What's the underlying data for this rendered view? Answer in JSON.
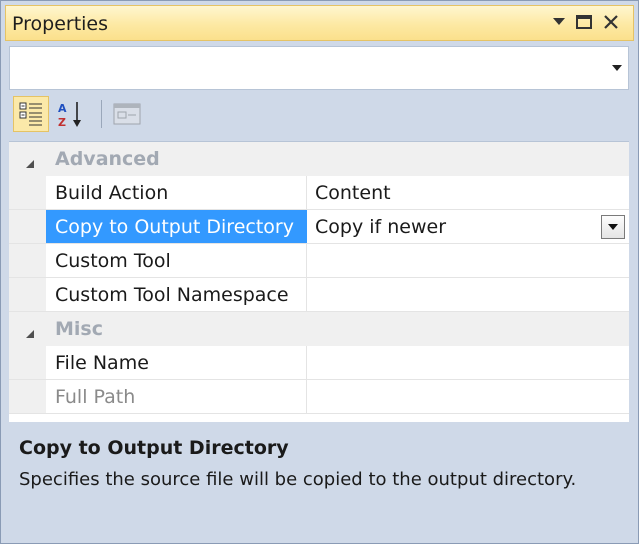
{
  "window": {
    "title": "Properties",
    "buttons": {
      "dropdown": "window-position-icon",
      "maximize": "maximize-icon",
      "close": "close-icon"
    }
  },
  "selector": {
    "value": "",
    "arrow_icon": "dropdown-arrow-icon"
  },
  "toolbar": {
    "categorized_icon": "categorized-icon",
    "alphabetical_icon": "alphabetical-sort-icon",
    "property_pages_icon": "property-pages-icon"
  },
  "grid": {
    "categories": [
      {
        "label": "Advanced",
        "properties": [
          {
            "name": "Build Action",
            "value": "Content"
          },
          {
            "name": "Copy to Output Directory",
            "value": "Copy if newer"
          },
          {
            "name": "Custom Tool",
            "value": ""
          },
          {
            "name": "Custom Tool Namespace",
            "value": ""
          }
        ]
      },
      {
        "label": "Misc",
        "properties": [
          {
            "name": "File Name",
            "value": ""
          },
          {
            "name": "Full Path",
            "value": ""
          }
        ]
      }
    ]
  },
  "description": {
    "title": "Copy to Output Directory",
    "text": "Specifies the source file will be copied to the output directory."
  },
  "colors": {
    "title_bar": "#fde9a3",
    "selection": "#3399ff",
    "frame": "#cfd9e8"
  }
}
